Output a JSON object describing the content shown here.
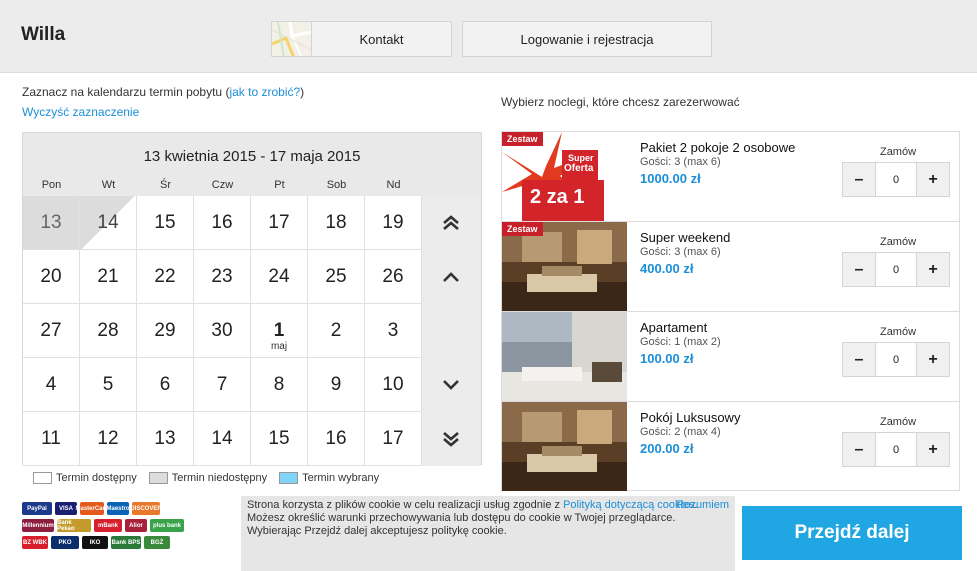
{
  "header": {
    "brand": "Willa",
    "contact_label": "Kontakt",
    "login_label": "Logowanie i rejestracja"
  },
  "instructions": {
    "prefix": "Zaznacz na kalendarzu termin pobytu (",
    "link": "jak to zrobić?",
    "suffix": ")",
    "clear": "Wyczyść zaznaczenie"
  },
  "calendar": {
    "range": "13 kwietnia 2015 - 17 maja 2015",
    "weekdays": [
      "Pon",
      "Wt",
      "Śr",
      "Czw",
      "Pt",
      "Sob",
      "Nd"
    ],
    "weeks": [
      [
        {
          "d": "13",
          "state": "unavailable"
        },
        {
          "d": "14",
          "state": "half"
        },
        {
          "d": "15"
        },
        {
          "d": "16"
        },
        {
          "d": "17"
        },
        {
          "d": "18"
        },
        {
          "d": "19"
        }
      ],
      [
        {
          "d": "20"
        },
        {
          "d": "21"
        },
        {
          "d": "22"
        },
        {
          "d": "23"
        },
        {
          "d": "24"
        },
        {
          "d": "25"
        },
        {
          "d": "26"
        }
      ],
      [
        {
          "d": "27"
        },
        {
          "d": "28"
        },
        {
          "d": "29"
        },
        {
          "d": "30"
        },
        {
          "d": "1",
          "month": "maj"
        },
        {
          "d": "2"
        },
        {
          "d": "3"
        }
      ],
      [
        {
          "d": "4"
        },
        {
          "d": "5"
        },
        {
          "d": "6"
        },
        {
          "d": "7"
        },
        {
          "d": "8"
        },
        {
          "d": "9"
        },
        {
          "d": "10"
        }
      ],
      [
        {
          "d": "11"
        },
        {
          "d": "12"
        },
        {
          "d": "13"
        },
        {
          "d": "14"
        },
        {
          "d": "15"
        },
        {
          "d": "16"
        },
        {
          "d": "17"
        }
      ]
    ],
    "legend": {
      "available": "Termin dostępny",
      "unavailable": "Termin niedostępny",
      "selected": "Termin wybrany"
    }
  },
  "offers_title": "Wybierz noclegi, które chcesz zarezerwować",
  "offers": [
    {
      "name": "Pakiet 2 pokoje 2 osobowe",
      "guests": "Gości: 3 (max 6)",
      "price": "1000.00 zł",
      "order_label": "Zamów",
      "qty": "0",
      "badge": "Zestaw",
      "image": "promo"
    },
    {
      "name": "Super weekend",
      "guests": "Gości: 3 (max 6)",
      "price": "400.00 zł",
      "order_label": "Zamów",
      "qty": "0",
      "badge": "Zestaw",
      "image": "room-warm"
    },
    {
      "name": "Apartament",
      "guests": "Gości: 1 (max 2)",
      "price": "100.00 zł",
      "order_label": "Zamów",
      "qty": "0",
      "badge": "",
      "image": "room-bright"
    },
    {
      "name": "Pokój Luksusowy",
      "guests": "Gości: 2 (max 4)",
      "price": "200.00 zł",
      "order_label": "Zamów",
      "qty": "0",
      "badge": "",
      "image": "room-warm"
    }
  ],
  "promo": {
    "line1": "Super",
    "line2": "Oferta",
    "line3": "2 za 1"
  },
  "payments": [
    "PayPal",
    "VISA",
    "MasterCard",
    "Maestro",
    "DISCOVER",
    "Millennium",
    "Bank Pekao",
    "mBank",
    "Alior",
    "plus bank",
    "BZ WBK",
    "PKO",
    "IKO",
    "Bank BPS",
    "BGŻ"
  ],
  "cookie": {
    "text1": "Strona korzysta z plików cookie w celu realizacji usług zgodnie z ",
    "link": "Polityką dotyczącą cookies",
    "text2": ". Możesz określić warunki przechowywania lub dostępu do cookie w Twojej przeglądarce. Wybierając Przejdź dalej akceptujesz politykę cookie.",
    "accept": "Rozumiem"
  },
  "proceed_label": "Przejdź dalej",
  "colors": {
    "accent": "#1fa6e3",
    "link": "#1a8fd8",
    "badge": "#c8202a",
    "selected": "#7fd4f7"
  }
}
